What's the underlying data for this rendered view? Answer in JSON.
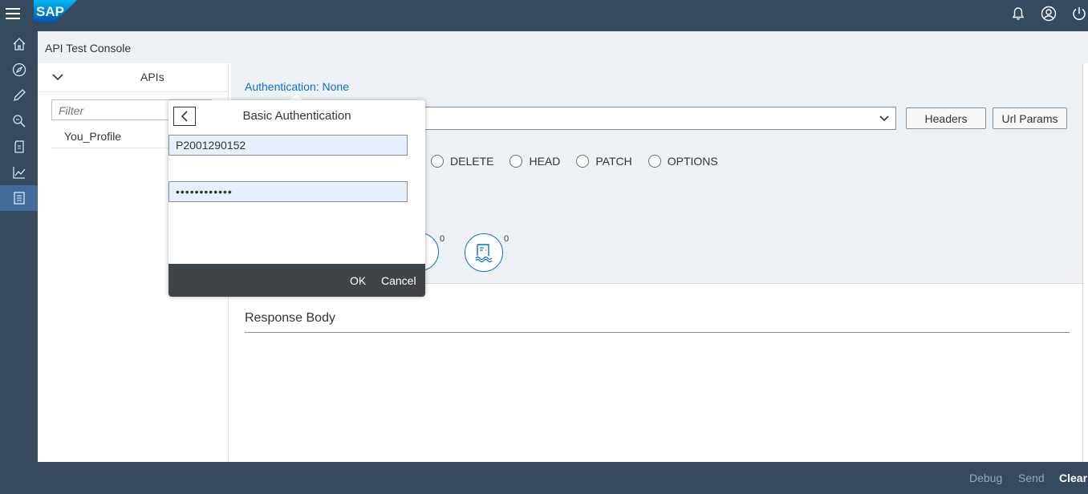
{
  "shell": {
    "logo_text": "SAP",
    "brand_color": "#0a6ed1",
    "icons": [
      "menu-icon",
      "bell-icon",
      "user-icon",
      "power-icon"
    ]
  },
  "rail": {
    "items": [
      "home-icon",
      "compass-icon",
      "pencil-icon",
      "inspect-icon",
      "document-icon",
      "analytics-icon",
      "list-icon"
    ],
    "active": "list-icon"
  },
  "app": {
    "title": "API Test Console"
  },
  "api_panel": {
    "title": "APIs",
    "filter_placeholder": "Filter",
    "items": [
      "You_Profile"
    ]
  },
  "request": {
    "auth_label": "Authentication: None",
    "headers_label": "Headers",
    "url_params_label": "Url Params",
    "methods": [
      "DELETE",
      "HEAD",
      "PATCH",
      "OPTIONS"
    ],
    "stats": [
      {
        "count": "0"
      },
      {
        "count": "0"
      }
    ]
  },
  "response": {
    "title": "Response Body"
  },
  "footer": {
    "debug_label": "Debug",
    "send_label": "Send",
    "clear_label": "Clear"
  },
  "popover": {
    "title": "Basic Authentication",
    "username_value": "P2001290152",
    "password_value": "••••••••••••",
    "ok_label": "OK",
    "cancel_label": "Cancel"
  }
}
